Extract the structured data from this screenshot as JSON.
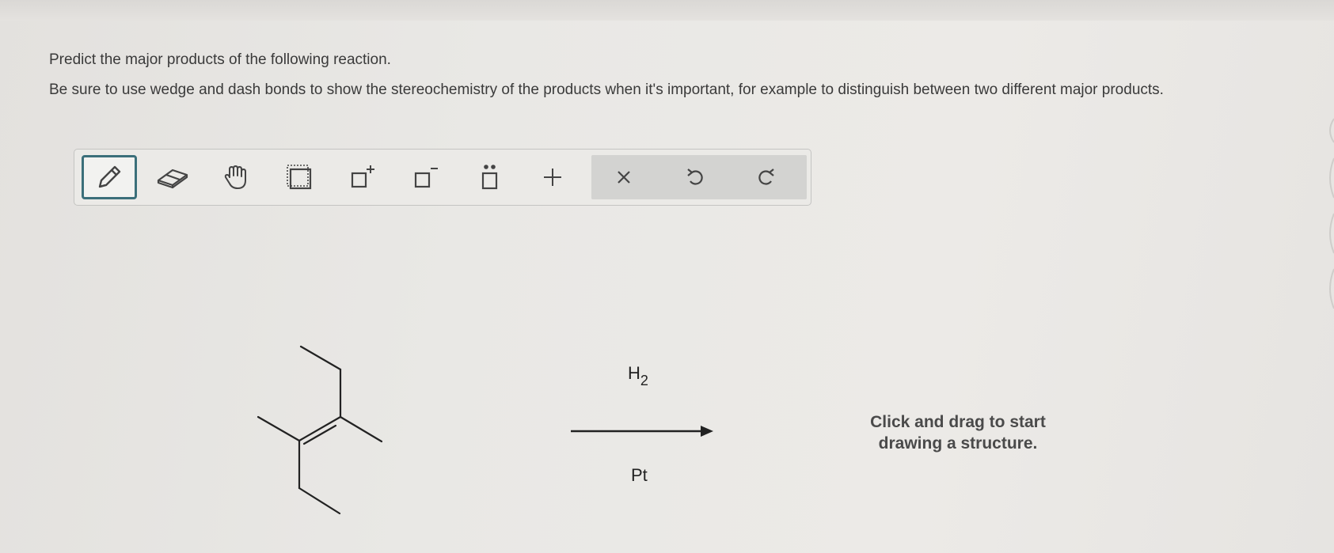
{
  "question": {
    "prompt": "Predict the major products of the following reaction.",
    "instructions": "Be sure to use wedge and dash bonds to show the stereochemistry of the products when it's important, for example to distinguish between two different major products."
  },
  "toolbar": {
    "tools": [
      {
        "name": "pencil-tool",
        "icon": "pencil-icon",
        "selected": true
      },
      {
        "name": "eraser-tool",
        "icon": "eraser-icon"
      },
      {
        "name": "hand-tool",
        "icon": "hand-icon"
      },
      {
        "name": "select-tool",
        "icon": "selection-box-icon"
      },
      {
        "name": "positive-charge-tool",
        "icon": "positive-charge-icon"
      },
      {
        "name": "negative-charge-tool",
        "icon": "negative-charge-icon"
      },
      {
        "name": "lone-pair-tool",
        "icon": "lone-pair-icon"
      },
      {
        "name": "add-tool",
        "icon": "plus-icon"
      },
      {
        "name": "clear-tool",
        "icon": "close-icon"
      },
      {
        "name": "undo-tool",
        "icon": "undo-icon"
      },
      {
        "name": "redo-tool",
        "icon": "redo-icon"
      }
    ],
    "accent_color": "#3b6f7a"
  },
  "reaction": {
    "reagent_above": "H",
    "reagent_above_subscript": "2",
    "reagent_below": "Pt"
  },
  "drawing_area": {
    "hint_line1": "Click and drag to start",
    "hint_line2": "drawing a structure."
  }
}
